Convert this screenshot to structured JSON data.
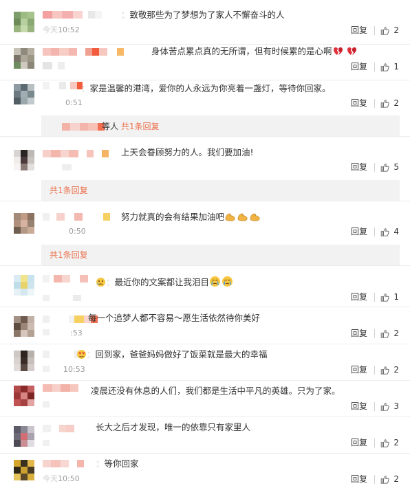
{
  "ui": {
    "reply_label": "回复",
    "more_reply_link": "共1条回复"
  },
  "colors": {
    "link": "#eb7350",
    "meta_text": "#999999",
    "subreply_bg": "#f2f2f2"
  },
  "comments": [
    {
      "text": "致敬那些为了梦想为了家人不懈奋斗的人",
      "time": "10:52",
      "time_prefix": "今天",
      "likes": "2",
      "emoji": ""
    },
    {
      "text": "身体苦点累点真的无所谓，但有时候累的是心啊",
      "time": "",
      "time_prefix": "",
      "likes": "1",
      "emoji": "broken-heart"
    },
    {
      "text": "家是温馨的港湾，爱你的人永远为你亮着一盏灯，等待你回家。",
      "time": "0:51",
      "time_prefix": "",
      "likes": "2",
      "emoji": ""
    },
    {
      "text": "上天会眷顾努力的人。我们要加油!",
      "time": "",
      "time_prefix": "",
      "likes": "5",
      "emoji": ""
    },
    {
      "text": "努力就真的会有结果加油吧",
      "time": "0:50",
      "time_prefix": "",
      "likes": "4",
      "emoji": "muscle"
    },
    {
      "text": "最近你的文案都让我泪目",
      "time": "",
      "time_prefix": "",
      "likes": "1",
      "emoji": "tear-face"
    },
    {
      "text": "每一个追梦人都不容易～愿生活依然待你美好",
      "time": ":53",
      "time_prefix": "",
      "likes": "2",
      "emoji": ""
    },
    {
      "text": "回到家，爸爸妈妈做好了饭菜就是最大的幸福",
      "time": "10:53",
      "time_prefix": "",
      "likes": "2",
      "emoji": ""
    },
    {
      "text": "凌晨还没有休息的人们，我们都是生活中平凡的英雄。只为了家。",
      "time": "",
      "time_prefix": "",
      "likes": "3",
      "emoji": ""
    },
    {
      "text": "长大之后才发现，唯一的依靠只有家里人",
      "time": "",
      "time_prefix": "",
      "likes": "2",
      "emoji": ""
    },
    {
      "text": "等你回家",
      "time": "10:50",
      "time_prefix": "今天",
      "likes": "2",
      "emoji": ""
    }
  ],
  "subreplies": [
    {
      "text": "等人",
      "link": "共1条回复"
    },
    {
      "text": "",
      "link": "共1条回复"
    },
    {
      "text": "",
      "link": "共1条回复"
    }
  ]
}
